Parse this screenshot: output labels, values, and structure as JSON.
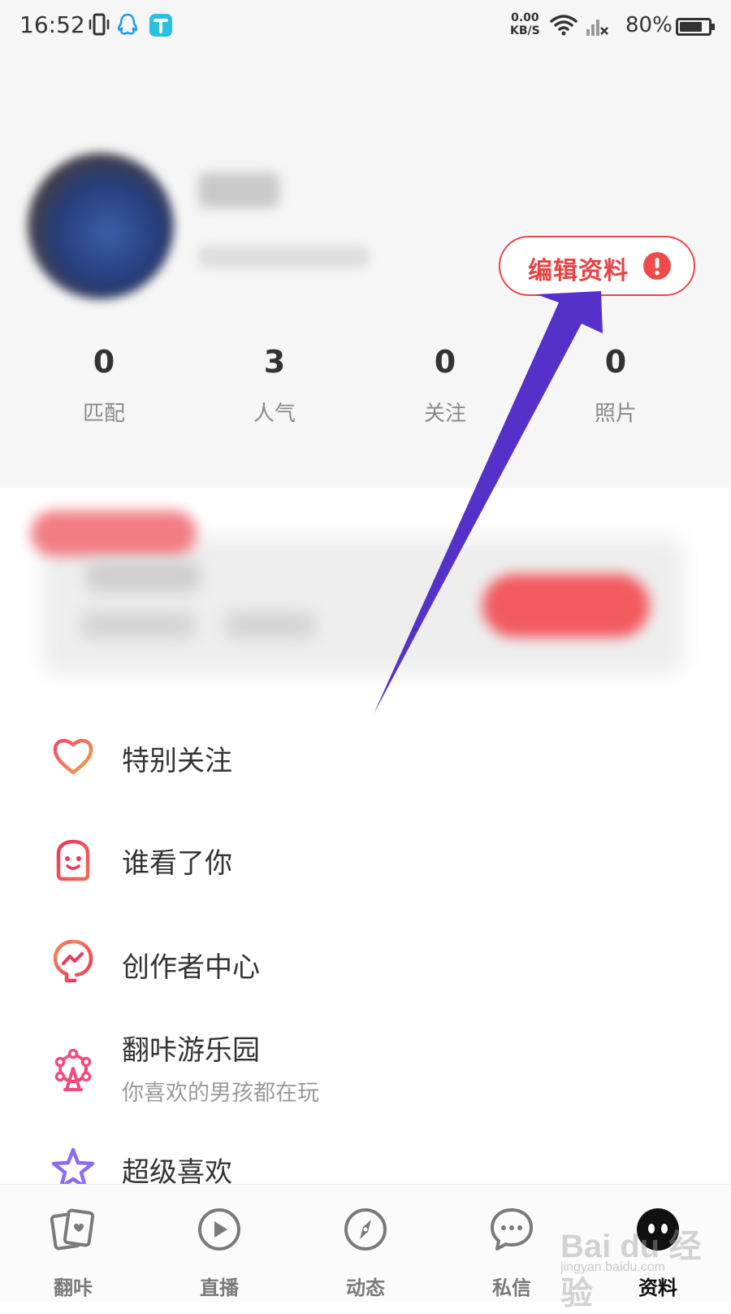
{
  "status_bar": {
    "time": "16:52",
    "net_speed_value": "0.00",
    "net_speed_unit": "KB/S",
    "battery_percent": "80%",
    "battery_level": 0.8
  },
  "profile": {
    "edit_button_label": "编辑资料"
  },
  "stats": [
    {
      "value": "0",
      "label": "匹配"
    },
    {
      "value": "3",
      "label": "人气"
    },
    {
      "value": "0",
      "label": "关注"
    },
    {
      "value": "0",
      "label": "照片"
    }
  ],
  "menu": [
    {
      "label": "特别关注",
      "icon": "heart-icon"
    },
    {
      "label": "谁看了你",
      "icon": "face-icon"
    },
    {
      "label": "创作者中心",
      "icon": "creator-chart-icon"
    },
    {
      "label": "翻咔游乐园",
      "sublabel": "你喜欢的男孩都在玩",
      "icon": "ferris-wheel-icon"
    },
    {
      "label": "超级喜欢",
      "icon": "star-icon"
    }
  ],
  "bottom_nav": [
    {
      "label": "翻咔",
      "icon": "cards-icon"
    },
    {
      "label": "直播",
      "icon": "play-icon"
    },
    {
      "label": "动态",
      "icon": "compass-icon"
    },
    {
      "label": "私信",
      "icon": "chat-icon"
    },
    {
      "label": "资料",
      "icon": "profile-face-icon",
      "active": true
    }
  ],
  "watermark": {
    "text": "Bai du 经验",
    "sub": "jingyan.baidu.com"
  },
  "colors": {
    "accent_red": "#e54545",
    "annotation_arrow": "#5531c9"
  }
}
